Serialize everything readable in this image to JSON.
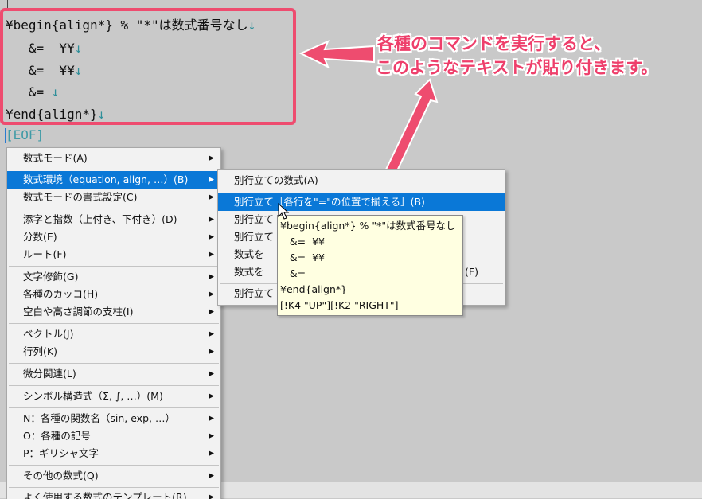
{
  "editor": {
    "lines": [
      "¥begin{align*} % \"*\"は数式番号なし",
      "   &=  ¥¥",
      "   &=  ¥¥",
      "   &= ",
      "¥end{align*}"
    ],
    "newline_glyph": "↓",
    "eof": "[EOF]"
  },
  "annotation": {
    "line1": "各種のコマンドを実行すると、",
    "line2": "このようなテキストが貼り付きます。",
    "color": "#ee3f6b"
  },
  "main_menu": {
    "items": [
      "数式モード(A)",
      "数式環境（equation, align, …）(B)",
      "数式モードの書式設定(C)",
      "添字と指数（上付き、下付き）(D)",
      "分数(E)",
      "ルート(F)",
      "文字修飾(G)",
      "各種のカッコ(H)",
      "空白や高さ調節の支柱(I)",
      "ベクトル(J)",
      "行列(K)",
      "微分関連(L)",
      "シンボル構造式（Σ, ∫, …）(M)",
      "N：各種の関数名（sin, exp, …）",
      "O：各種の記号",
      "P：ギリシャ文字",
      "その他の数式(Q)",
      "よく使用する数式のテンプレート(R)"
    ],
    "selected_index": 1
  },
  "submenu": {
    "items": [
      "別行立ての数式(A)",
      "別行立て［各行を\"=\"の位置で揃える］(B)",
      "別行立て",
      "別行立て",
      "数式を",
      "数式を",
      "別行立て"
    ],
    "partial_right": "(F)",
    "selected_index": 1
  },
  "tooltip": {
    "lines": [
      "¥begin{align*} % \"*\"は数式番号なし",
      "   &=  ¥¥",
      "   &=  ¥¥",
      "   &=",
      "¥end{align*}",
      "[!K4 \"UP\"][!K2 \"RIGHT\"]"
    ]
  },
  "colors": {
    "accent_pink": "#ee4c6f",
    "menu_selection": "#0a78d7",
    "tooltip_bg": "#ffffe1",
    "editor_bg": "#c9c9c9"
  }
}
